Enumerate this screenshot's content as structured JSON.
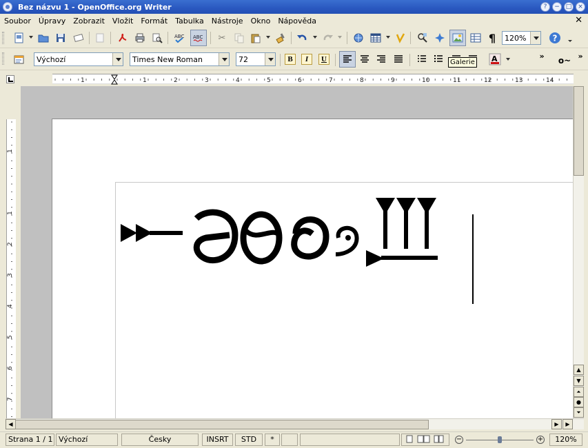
{
  "window": {
    "title": "Bez názvu 1 - OpenOffice.org Writer"
  },
  "menu": {
    "items": [
      "Soubor",
      "Úpravy",
      "Zobrazit",
      "Vložit",
      "Formát",
      "Tabulka",
      "Nástroje",
      "Okno",
      "Nápověda"
    ]
  },
  "toolbar": {
    "zoom_value": "120%",
    "tooltip": "Galerie"
  },
  "formatting": {
    "paragraph_style": "Výchozí",
    "font_name": "Times New Roman",
    "font_size": "72",
    "bold_label": "B",
    "italic_label": "I",
    "underline_label": "U"
  },
  "ruler": {
    "h_numbers": [
      "1",
      "1",
      "2",
      "3",
      "4",
      "5",
      "6",
      "7",
      "8",
      "9",
      "10",
      "11",
      "12",
      "13",
      "14"
    ],
    "v_numbers": [
      "1",
      "1",
      "2",
      "3",
      "4",
      "5",
      "6",
      "7"
    ]
  },
  "status": {
    "page": "Strana 1 / 1",
    "style": "Výchozí",
    "language": "Česky",
    "insert_mode": "INSRT",
    "selection_mode": "STD",
    "modified": "*",
    "zoom": "120%"
  },
  "colors": {
    "titlebar": "#2a58c0",
    "chrome": "#ece9d8",
    "doc_background": "#c0c0c0",
    "page": "#ffffff"
  }
}
